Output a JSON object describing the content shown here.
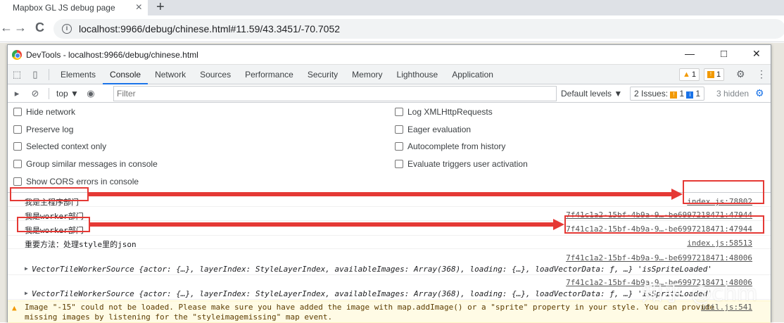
{
  "browser": {
    "tab_title": "Mapbox GL JS debug page",
    "tab_close": "×",
    "new_tab": "+",
    "back": "←",
    "forward": "→",
    "reload": "C",
    "url": "localhost:9966/debug/chinese.html#11.59/43.3451/-70.7052"
  },
  "devtools": {
    "title": "DevTools - localhost:9966/debug/chinese.html",
    "minimize": "—",
    "maximize": "□",
    "close": "✕",
    "tabs": [
      "Elements",
      "Console",
      "Network",
      "Sources",
      "Performance",
      "Security",
      "Memory",
      "Lighthouse",
      "Application"
    ],
    "active_tab": "Console",
    "warnings_count": "1",
    "messages_count": "1"
  },
  "console_toolbar": {
    "context": "top ▼",
    "filter_placeholder": "Filter",
    "levels": "Default levels ▼",
    "issues_label": "2 Issues:",
    "issues_warn": "1",
    "issues_info": "1",
    "hidden": "3 hidden"
  },
  "settings": {
    "left": [
      "Hide network",
      "Preserve log",
      "Selected context only",
      "Group similar messages in console",
      "Show CORS errors in console"
    ],
    "right": [
      "Log XMLHttpRequests",
      "Eager evaluation",
      "Autocomplete from history",
      "Evaluate triggers user activation"
    ]
  },
  "messages": [
    {
      "text": "我是主程序部门",
      "source": "index.js:78802"
    },
    {
      "text": "我是worker部门",
      "source": "7f41c1a2-15bf-4b9a-9…-be6997218471:47944"
    },
    {
      "text": "我是worker部门",
      "source": "7f41c1a2-15bf-4b9a-9…-be6997218471:47944"
    },
    {
      "text": "重要方法：处理style里的json",
      "source": "index.js:58513"
    },
    {
      "text": "",
      "source": "7f41c1a2-15bf-4b9a-9…-be6997218471:48006"
    },
    {
      "text": "VectorTileWorkerSource {actor: {…}, layerIndex: StyleLayerIndex, availableImages: Array(368), loading: {…}, loadVectorData: ƒ, …} 'isSpriteLoaded'",
      "source": ""
    },
    {
      "text": "",
      "source": "7f41c1a2-15bf-4b9a-9…-be6997218471:48006"
    },
    {
      "text": "VectorTileWorkerSource {actor: {…}, layerIndex: StyleLayerIndex, availableImages: Array(368), loading: {…}, loadVectorData: ƒ, …} 'isSpriteLoaded'",
      "source": ""
    },
    {
      "text": "Image \"-15\" could not be loaded. Please make sure you have added the image with map.addImage() or a \"sprite\" property in your style. You can provide",
      "source": "util.js:541"
    },
    {
      "text": "missing images by listening for the \"styleimagemissing\" map event.",
      "source": ""
    }
  ],
  "watermark": "知乎 @chm",
  "colors": {
    "annotation": "#e53935",
    "accent": "#1a73e8",
    "warning_bg": "#fffbe5"
  }
}
